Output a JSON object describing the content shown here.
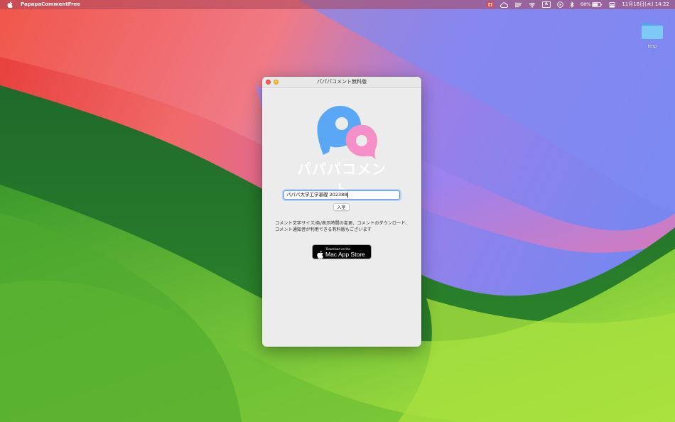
{
  "menubar": {
    "app_name": "PapapaCommentFree",
    "battery_percent": "68%",
    "input_mode": "A",
    "datetime": "11月16日(木) 14:22",
    "icons": [
      "apple-icon",
      "extension-icon",
      "creative-cloud-icon",
      "cast-icon",
      "wifi-icon",
      "input-source-icon",
      "play-icon",
      "bluetooth-icon",
      "battery-icon",
      "control-center-icon"
    ]
  },
  "desktop": {
    "folder_label": "tmp"
  },
  "window": {
    "title": "パパパコメント無料版",
    "logo_text": "パパパコメント",
    "room_input": {
      "value": "パパパ大学工学基礎 202388"
    },
    "enter_button": "入室",
    "promo_text": "コメント文字サイズ/色/表示時間の変更、コメントのダウンロード、コメント通知音が利用できる有料版もございます",
    "appstore_badge": {
      "small": "Download on the",
      "big": "Mac App Store"
    }
  },
  "colors": {
    "logo_blue": "#5aa8f5",
    "logo_pink": "#f58fc7",
    "accent": "#5b9bf0"
  }
}
